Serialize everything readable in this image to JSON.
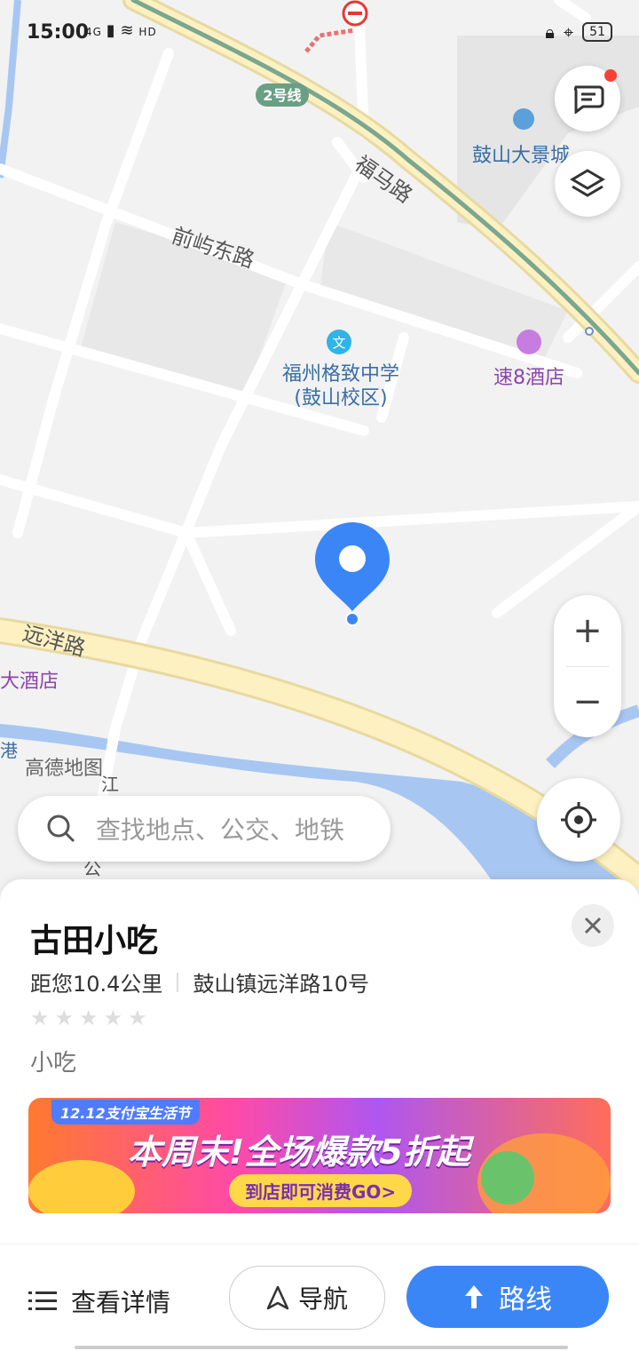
{
  "status_bar": {
    "time": "15:00",
    "network": "4G",
    "hd": "HD",
    "battery": "51"
  },
  "map": {
    "metro_line": "2号线",
    "roads": [
      "福马路",
      "前屿东路",
      "远洋路"
    ],
    "pois": [
      {
        "name": "鼓山大景城"
      },
      {
        "name": "福州格致中学",
        "sub": "(鼓山校区)"
      },
      {
        "name": "速8酒店"
      },
      {
        "name": "大酒店"
      },
      {
        "name": "港"
      },
      {
        "name": "江"
      },
      {
        "name": "公"
      }
    ],
    "watermark": "高德地图",
    "school_icon": "文"
  },
  "controls": {
    "zoom_in": "+",
    "zoom_out": "−"
  },
  "search": {
    "placeholder": "查找地点、公交、地铁"
  },
  "place": {
    "name": "古田小吃",
    "distance": "距您10.4公里",
    "address": "鼓山镇远洋路10号",
    "rating_stars": 0,
    "category": "小吃"
  },
  "banner": {
    "tag": "12.12支付宝生活节",
    "headline": "本周末!全场爆款5折起",
    "cta": "到店即可消费GO>"
  },
  "actions": {
    "detail": "查看详情",
    "navigate": "导航",
    "route": "路线"
  },
  "colors": {
    "accent": "#3b86f7",
    "road": "#fdf1c2",
    "water": "#a7c7f2",
    "metro": "#7aa790"
  }
}
